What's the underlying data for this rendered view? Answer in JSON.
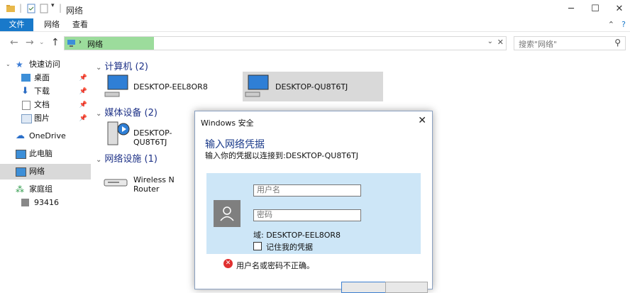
{
  "window": {
    "title": "网络",
    "minimize": "─",
    "maximize": "☐",
    "close": "✕"
  },
  "ribbon": {
    "tabs": [
      "文件",
      "网络",
      "查看"
    ],
    "collapse": "⌃",
    "help": "?"
  },
  "address": {
    "location": "网络",
    "search_placeholder": "搜索\"网络\""
  },
  "sidebar": {
    "items": [
      {
        "label": "快速访问",
        "icon": "star-icon",
        "pinned": false
      },
      {
        "label": "桌面",
        "icon": "desktop-folder-icon",
        "pinned": true
      },
      {
        "label": "下载",
        "icon": "download-icon",
        "pinned": true
      },
      {
        "label": "文档",
        "icon": "document-icon",
        "pinned": true
      },
      {
        "label": "图片",
        "icon": "picture-icon",
        "pinned": true
      },
      {
        "label": "OneDrive",
        "icon": "cloud-icon",
        "pinned": false
      },
      {
        "label": "此电脑",
        "icon": "computer-icon",
        "pinned": false
      },
      {
        "label": "网络",
        "icon": "network-icon",
        "pinned": false
      },
      {
        "label": "家庭组",
        "icon": "homegroup-icon",
        "pinned": false
      },
      {
        "label": "93416",
        "icon": "user-icon",
        "pinned": false
      }
    ]
  },
  "groups": {
    "computers": {
      "title": "计算机 (2)",
      "items": [
        "DESKTOP-EEL8OR8",
        "DESKTOP-QU8T6TJ"
      ]
    },
    "media": {
      "title": "媒体设备 (2)",
      "items": [
        "DESKTOP-QU8T6TJ"
      ]
    },
    "infrastructure": {
      "title": "网络设施 (1)",
      "items": [
        "Wireless N Router"
      ]
    }
  },
  "dialog": {
    "title": "Windows 安全",
    "heading": "输入网络凭据",
    "subtitle": "输入你的凭据以连接到:DESKTOP-QU8T6TJ",
    "username_placeholder": "用户名",
    "password_placeholder": "密码",
    "domain": "域: DESKTOP-EEL8OR8",
    "remember": "记住我的凭据",
    "error": "用户名或密码不正确。"
  },
  "colors": {
    "accent": "#1979ca",
    "address_highlight": "#9cdc9c",
    "credential_panel": "#cde6f7",
    "error": "#e03030"
  }
}
